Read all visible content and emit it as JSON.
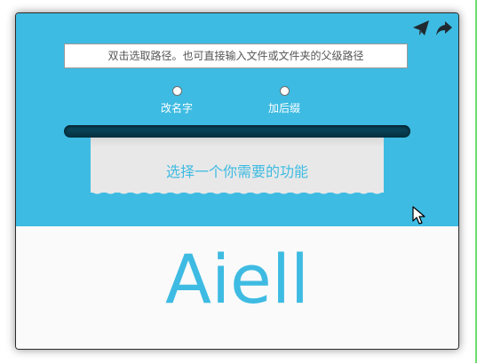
{
  "window": {
    "accent_color": "#3ebbe2"
  },
  "titlebar": {
    "icons": [
      "send-icon",
      "share-icon"
    ]
  },
  "path_input": {
    "placeholder": "双击选取路径。也可直接输入文件或文件夹的父级路径",
    "value": ""
  },
  "options": [
    {
      "label": "改名字"
    },
    {
      "label": "加后缀"
    }
  ],
  "feature_prompt": "选择一个你需要的功能",
  "logo": "Aiell"
}
